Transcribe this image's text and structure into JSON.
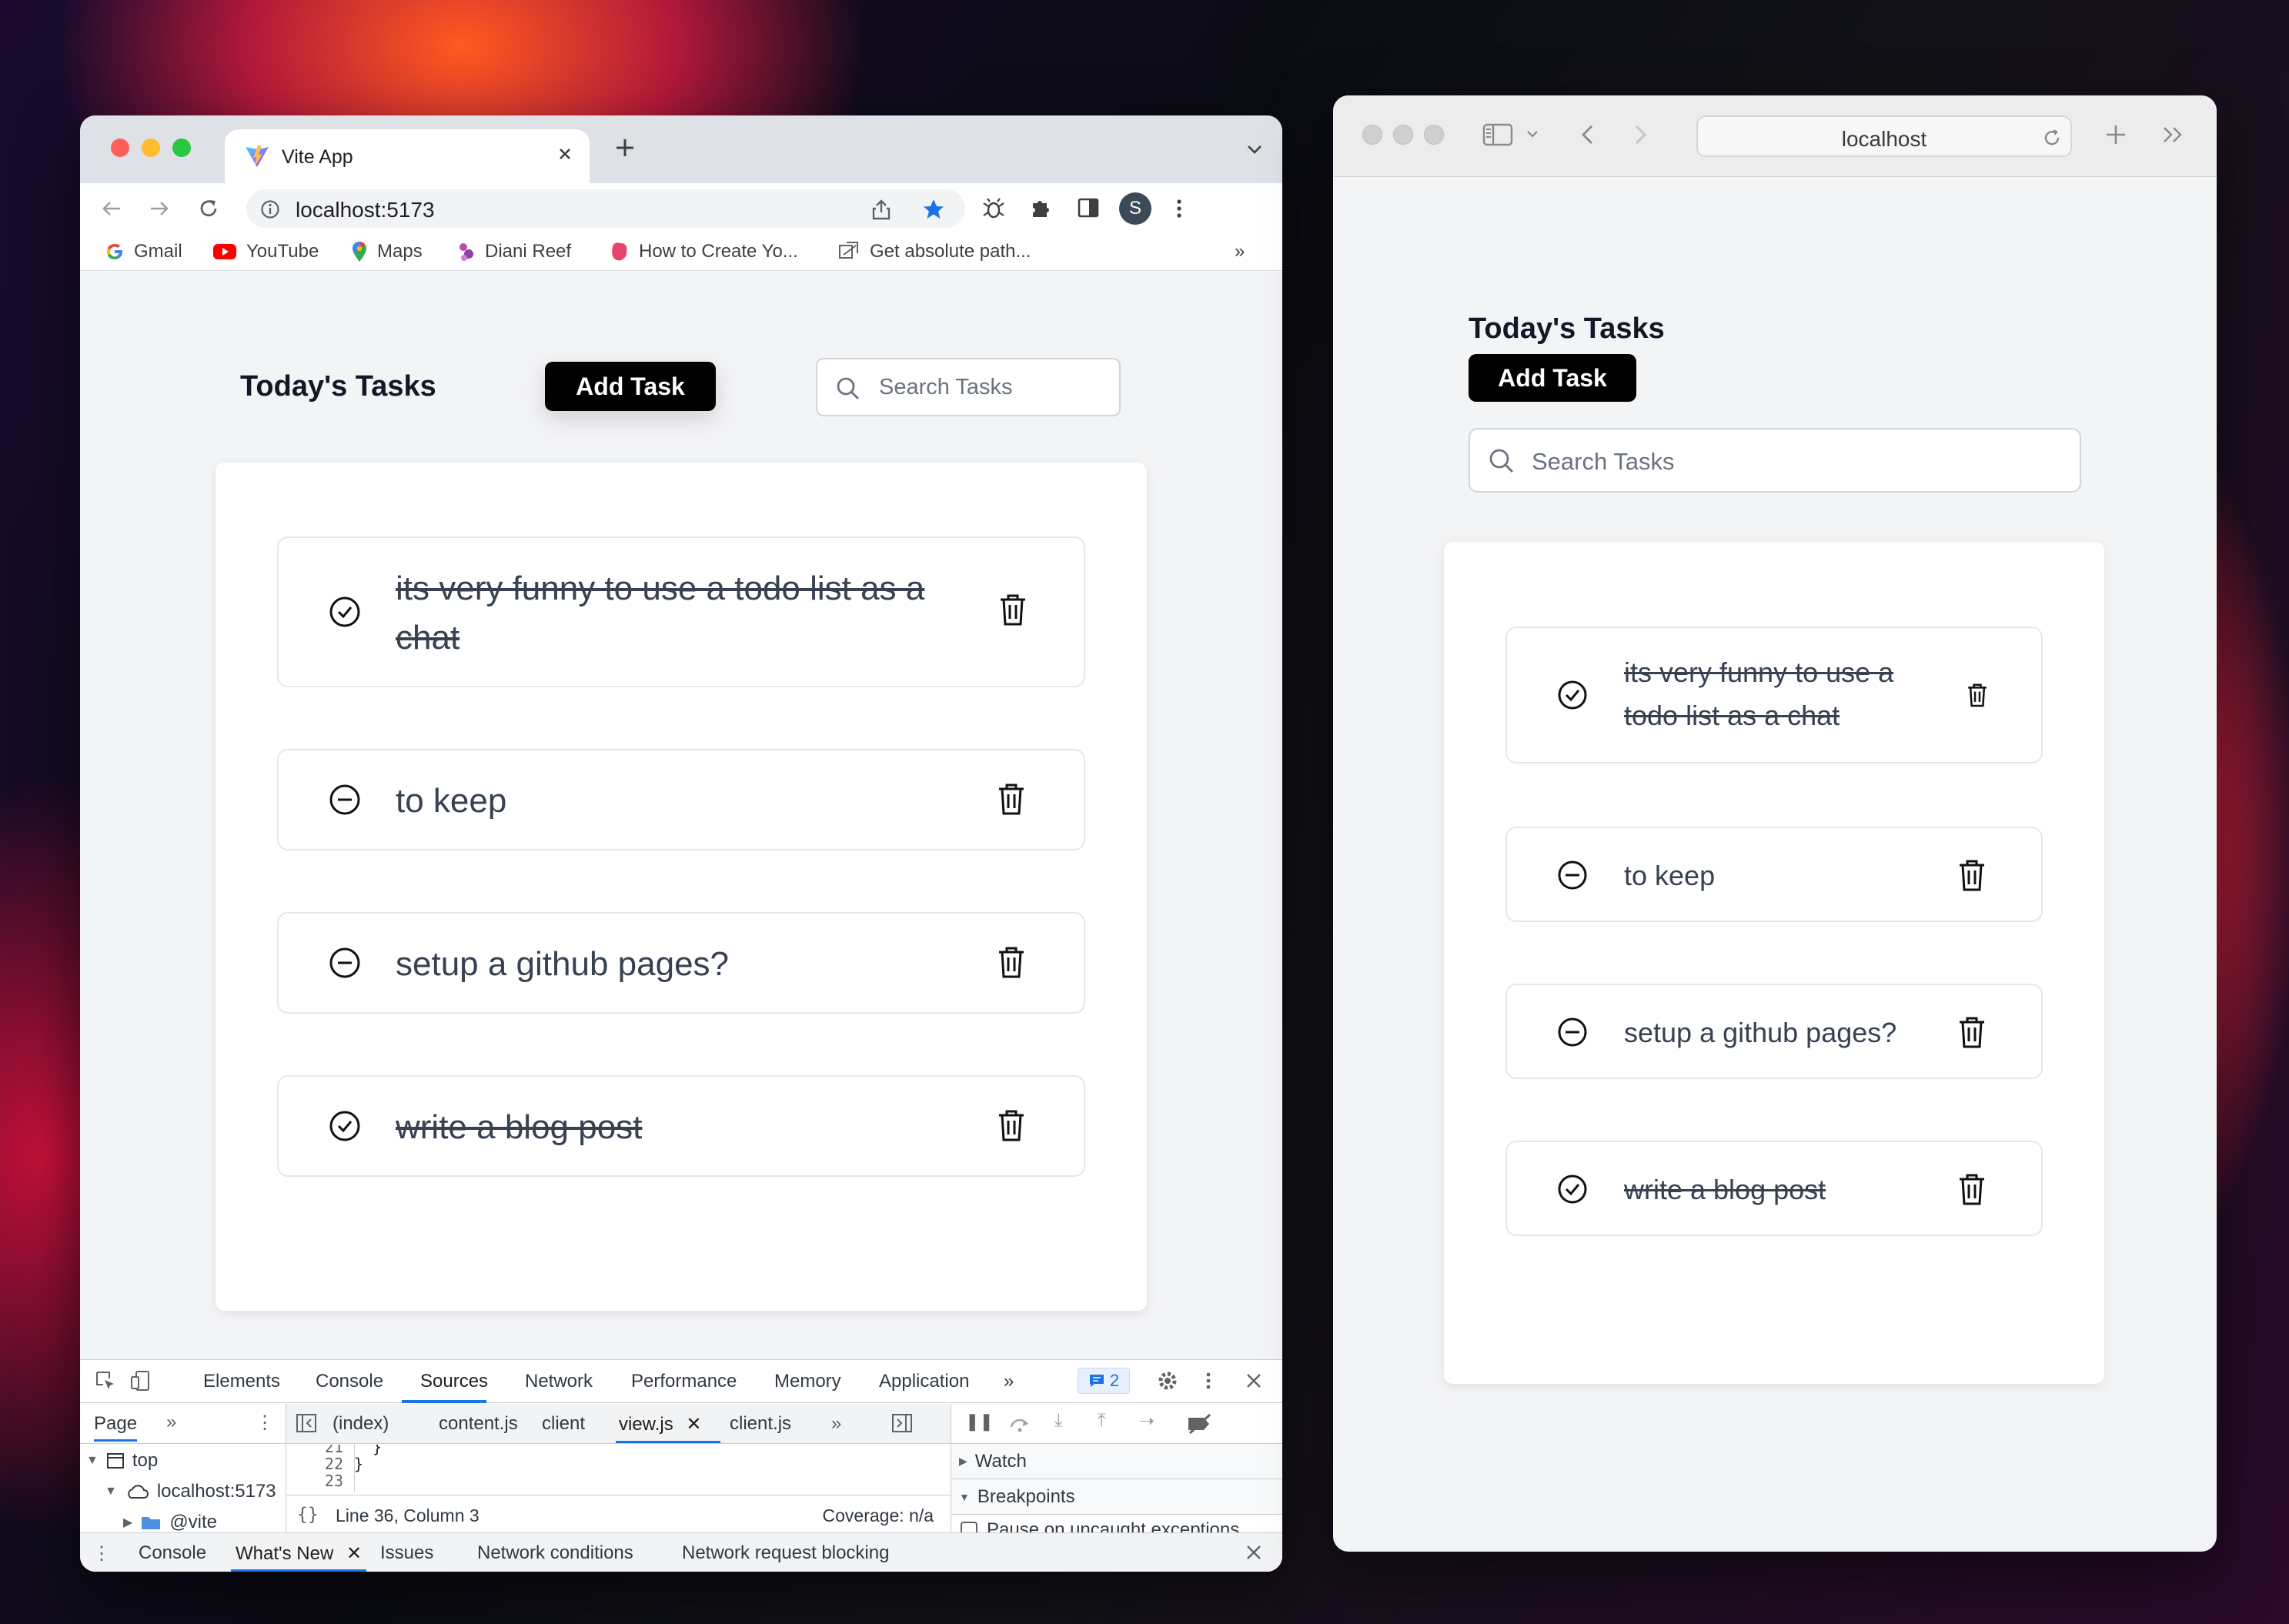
{
  "chrome": {
    "tab_title": "Vite App",
    "url": "localhost:5173",
    "profile_initial": "S",
    "bookmarks": [
      {
        "label": "Gmail",
        "icon": "google-icon"
      },
      {
        "label": "YouTube",
        "icon": "youtube-icon"
      },
      {
        "label": "Maps",
        "icon": "maps-icon"
      },
      {
        "label": "Diani Reef",
        "icon": "bookmark-favicon"
      },
      {
        "label": "How to Create Yo...",
        "icon": "bookmark-favicon"
      },
      {
        "label": "Get absolute path...",
        "icon": "bookmark-favicon"
      }
    ],
    "bookmarks_overflow": "»"
  },
  "app": {
    "title": "Today's Tasks",
    "add_label": "Add Task",
    "search_placeholder": "Search Tasks",
    "tasks": [
      {
        "text": "its very funny to use a todo list as a chat",
        "done": true
      },
      {
        "text": "to keep",
        "done": false
      },
      {
        "text": "setup a github pages?",
        "done": false
      },
      {
        "text": "write a blog post",
        "done": true
      }
    ]
  },
  "devtools": {
    "tabs": [
      "Elements",
      "Console",
      "Sources",
      "Network",
      "Performance",
      "Memory",
      "Application"
    ],
    "active_tab": "Sources",
    "issues_count": "2",
    "navigator_tab": "Page",
    "tree": [
      "top",
      "localhost:5173",
      "@vite"
    ],
    "file_tabs": [
      "(index)",
      "content.js",
      "client",
      "view.js",
      "client.js"
    ],
    "active_file": "view.js",
    "code_lines": [
      {
        "num": "21",
        "code": "  }"
      },
      {
        "num": "22",
        "code": "}"
      },
      {
        "num": "23",
        "code": ""
      }
    ],
    "status_position": "Line 36, Column 3",
    "status_coverage": "Coverage: n/a",
    "debugger_sections": [
      "Watch",
      "Breakpoints"
    ],
    "pause_uncaught": "Pause on uncaught exceptions",
    "drawer_tabs": [
      "Console",
      "What's New",
      "Issues",
      "Network conditions",
      "Network request blocking"
    ],
    "active_drawer_tab": "What's New"
  },
  "safari": {
    "url": "localhost"
  },
  "colors": {
    "accent_blue": "#1a73e8",
    "button_black": "#000000",
    "page_bg": "#f3f4f6"
  }
}
